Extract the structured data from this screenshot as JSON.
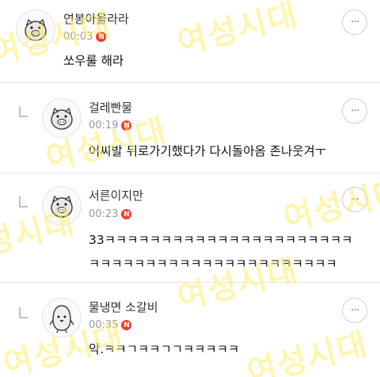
{
  "comments": [
    {
      "username": "연봉아올라라",
      "time": "00:03",
      "new_badge": "N",
      "avatar_icon": "pig-face-icon",
      "lines": [
        "쏘우룰 해라"
      ]
    },
    {
      "username": "걸레빤물",
      "time": "00:19",
      "new_badge": "N",
      "avatar_icon": "pig-face-icon",
      "lines": [
        "어씨발 뒤로가기했다가 다시돌아옴 존나웃겨ㅜ"
      ]
    },
    {
      "username": "서른이지만",
      "time": "00:23",
      "new_badge": "N",
      "avatar_icon": "pig-face-icon",
      "lines": [
        "33ㅋㅋㅋㅋㅋㅋㅋㅋㅋㅋㅋㅋㅋㅋㅋㅋㅋㅋㅋㅋㅋㅋ",
        "ㅋㅋㅋㅋㅋㅋㅋㅋㅋㅋㅋㅋㅋㅋㅋㅋㅋㅋㅋㅋㅋㅋ"
      ]
    },
    {
      "username": "물냉면 소갈비",
      "time": "00:35",
      "new_badge": "N",
      "avatar_icon": "penguin-icon",
      "lines": [
        "악.ㅋㅋㄱㅋㅋㄱㄱㅋㅋㅋㅋㅋ"
      ]
    }
  ],
  "more_button_label": "···",
  "watermark_text": "여성시대"
}
